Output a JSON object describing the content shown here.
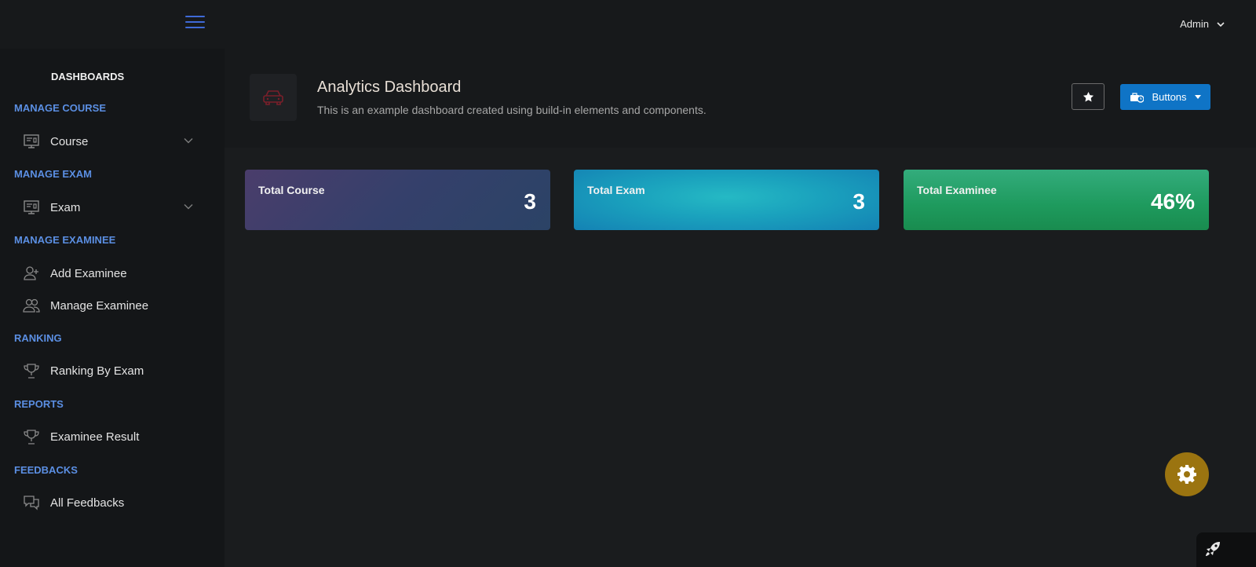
{
  "topbar": {
    "menu_icon": "hamburger-icon",
    "user_label": "Admin"
  },
  "sidebar": {
    "top_heading": "DASHBOARDS",
    "sections": [
      {
        "heading": "MANAGE COURSE",
        "items": [
          {
            "label": "Course",
            "icon": "monitor-icon",
            "expandable": true
          }
        ]
      },
      {
        "heading": "MANAGE EXAM",
        "items": [
          {
            "label": "Exam",
            "icon": "monitor-icon",
            "expandable": true
          }
        ]
      },
      {
        "heading": "MANAGE EXAMINEE",
        "items": [
          {
            "label": "Add Examinee",
            "icon": "user-add-icon"
          },
          {
            "label": "Manage Examinee",
            "icon": "users-icon"
          }
        ]
      },
      {
        "heading": "RANKING",
        "items": [
          {
            "label": "Ranking By Exam",
            "icon": "trophy-icon"
          }
        ]
      },
      {
        "heading": "REPORTS",
        "items": [
          {
            "label": "Examinee Result",
            "icon": "trophy-icon"
          }
        ]
      },
      {
        "heading": "FEEDBACKS",
        "items": [
          {
            "label": "All Feedbacks",
            "icon": "chat-icon"
          }
        ]
      }
    ]
  },
  "header": {
    "icon": "car-icon",
    "title": "Analytics Dashboard",
    "subtitle": "This is an example dashboard created using build-in elements and components.",
    "star_icon": "star-icon",
    "buttons_label": "Buttons",
    "buttons_icon": "business-time-icon"
  },
  "cards": [
    {
      "title": "Total Course",
      "value": "3"
    },
    {
      "title": "Total Exam",
      "value": "3"
    },
    {
      "title": "Total Examinee",
      "value": "46%"
    }
  ],
  "colors": {
    "accent": "#3f6ad8",
    "section_heading": "#5b8fe3",
    "primary_button": "#0f74c6",
    "fab": "#9b7410"
  }
}
